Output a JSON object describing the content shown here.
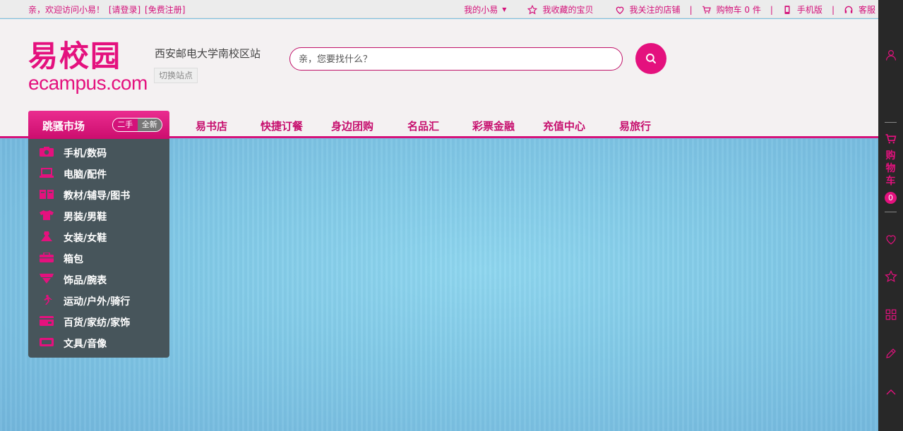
{
  "topbar": {
    "welcome": "亲，欢迎访问小易！",
    "login": "[请登录]",
    "register": "[免费注册]",
    "my_account": "我的小易",
    "favorites": "我收藏的宝贝",
    "followed_shops": "我关注的店铺",
    "cart": "购物车 0 件",
    "mobile": "手机版",
    "service": "客服"
  },
  "header": {
    "logo_cn": "易校园",
    "logo_en": "ecampus.com",
    "site_name": "西安邮电大学南校区站",
    "switch_site": "切换站点",
    "search_placeholder": "亲，您要找什么？"
  },
  "market": {
    "title": "跳骚市场",
    "toggle_used": "二手",
    "toggle_new": "全新"
  },
  "nav": {
    "items": [
      "易书店",
      "快捷订餐",
      "身边团购",
      "名品汇",
      "彩票金融",
      "充值中心",
      "易旅行"
    ]
  },
  "categories": [
    {
      "label": "手机/数码",
      "icon": "camera-icon"
    },
    {
      "label": "电脑/配件",
      "icon": "laptop-icon"
    },
    {
      "label": "教材/辅导/图书",
      "icon": "book-icon"
    },
    {
      "label": "男装/男鞋",
      "icon": "shirt-icon"
    },
    {
      "label": "女装/女鞋",
      "icon": "dress-icon"
    },
    {
      "label": "箱包",
      "icon": "bag-icon"
    },
    {
      "label": "饰品/腕表",
      "icon": "jewelry-icon"
    },
    {
      "label": "运动/户外/骑行",
      "icon": "runner-icon"
    },
    {
      "label": "百货/家纺/家饰",
      "icon": "home-icon"
    },
    {
      "label": "文具/音像",
      "icon": "stationery-icon"
    }
  ],
  "sidebar": {
    "cart_label": "购物车",
    "cart_count": "0"
  },
  "colors": {
    "accent": "#e4117e",
    "menu_bg": "#47555b",
    "sidebar_bg": "#282828"
  }
}
